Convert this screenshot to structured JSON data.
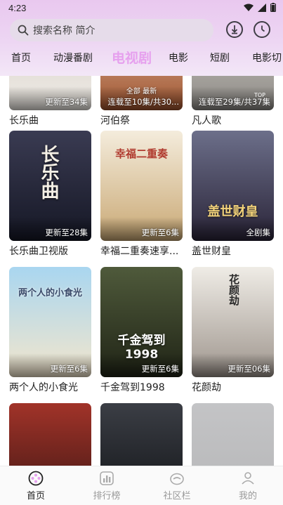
{
  "status_bar": {
    "time": "4:23"
  },
  "search": {
    "placeholder": "搜索名称 简介"
  },
  "tabs": [
    {
      "label": "首页",
      "active": false
    },
    {
      "label": "动漫番剧",
      "active": false
    },
    {
      "label": "电视剧",
      "active": true
    },
    {
      "label": "电影",
      "active": false
    },
    {
      "label": "短剧",
      "active": false
    },
    {
      "label": "电影切",
      "active": false
    }
  ],
  "partial_row": [
    {
      "title": "长乐曲",
      "badge": "更新至34集"
    },
    {
      "title": "河伯祭",
      "badge": "连载至10集/共30...",
      "overlay": "全部 最新"
    },
    {
      "title": "凡人歌",
      "badge": "连载至29集/共37集",
      "top_label": "TOP"
    }
  ],
  "grid": [
    {
      "title": "长乐曲卫视版",
      "badge": "更新至28集",
      "logo": "长乐曲",
      "color1": "#3a3b52",
      "color2": "#151725"
    },
    {
      "title": "幸福二重奏速享...",
      "badge": "更新至6集",
      "logo": "幸福二重奏",
      "color1": "#f4ecdc",
      "color2": "#c9a874"
    },
    {
      "title": "盖世财皇",
      "badge": "全剧集",
      "logo": "盖世财皇",
      "color1": "#6c6f8a",
      "color2": "#2a2438"
    },
    {
      "title": "两个人的小食光",
      "badge": "更新至6集",
      "logo": "两个人的小食光",
      "color1": "#a9d6f0",
      "color2": "#f3e6cc"
    },
    {
      "title": "千金驾到1998",
      "badge": "更新至6集",
      "logo": "千金驾到 1998",
      "color1": "#4f5a3b",
      "color2": "#202416"
    },
    {
      "title": "花颜劫",
      "badge": "更新至06集",
      "logo": "花颜劫",
      "color1": "#efece6",
      "color2": "#9e958d"
    }
  ],
  "last_row": [
    {
      "color1": "#a13329",
      "color2": "#3a1512"
    },
    {
      "color1": "#3b3e45",
      "color2": "#0f1114"
    },
    {
      "color1": "#55565c",
      "color2": "#2b2c30"
    }
  ],
  "bottom_nav": [
    {
      "label": "首页",
      "active": true
    },
    {
      "label": "排行榜",
      "active": false
    },
    {
      "label": "社区栏",
      "active": false
    },
    {
      "label": "我的",
      "active": false
    }
  ]
}
